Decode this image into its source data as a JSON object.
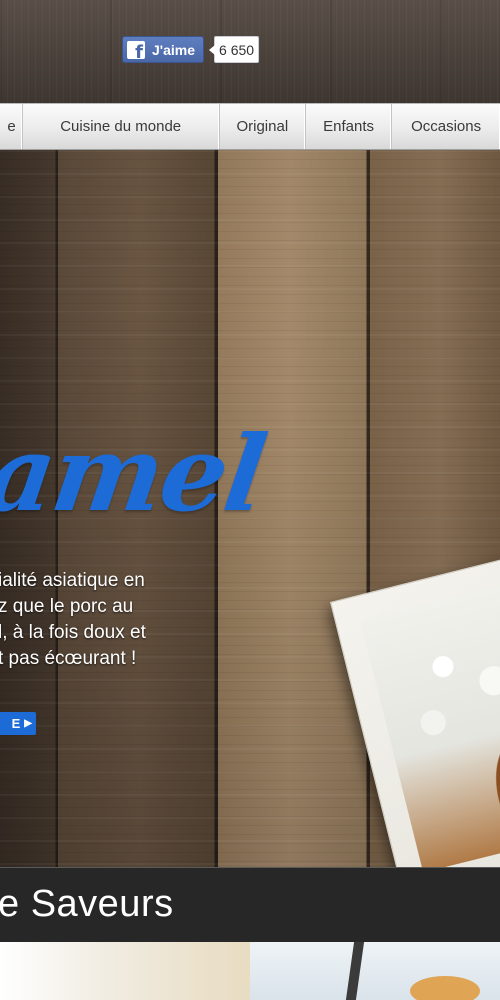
{
  "facebook": {
    "like_label": "J'aime",
    "like_count": "6 650",
    "brand_color": "#4a67a8"
  },
  "nav": {
    "items": [
      {
        "label": "e"
      },
      {
        "label": "Cuisine du monde"
      },
      {
        "label": "Original"
      },
      {
        "label": "Enfants"
      },
      {
        "label": "Occasions"
      }
    ]
  },
  "hero": {
    "title": "amel",
    "title_color": "#1d6bd6",
    "description_lines": [
      "ialité asiatique en",
      "z que le porc au",
      "l, à la fois doux et",
      "t pas écœurant !"
    ],
    "button_label": "E",
    "button_icon": "play-arrow-icon"
  },
  "section": {
    "title": "e Saveurs"
  }
}
